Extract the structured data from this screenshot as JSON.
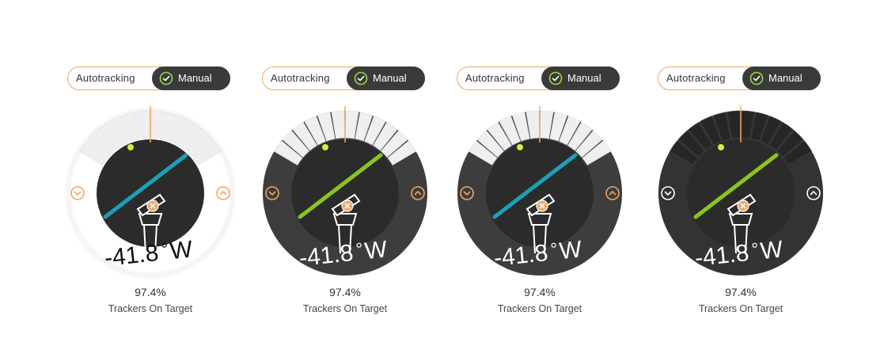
{
  "colors": {
    "accent_orange": "#f0a75f",
    "dial_dark": "#2b2b2b",
    "dial_ring_dark": "#3d3d3d",
    "blue_line": "#1aa0b8",
    "green_line": "#8cc41e",
    "dot_yellow": "#d8ef3c"
  },
  "icons": [
    "check-circle-icon",
    "chevron-down-icon",
    "chevron-up-icon",
    "tracker-icon",
    "target-x-icon"
  ],
  "cards": [
    {
      "toggle": {
        "auto_label": "Autotracking",
        "manual_label": "Manual"
      },
      "angle_value": "-41.8",
      "angle_unit": "°",
      "angle_dir": "W",
      "percent": "97.4%",
      "caption": "Trackers On Target",
      "theme": "light",
      "line_color": "blue",
      "control_style": "orange"
    },
    {
      "toggle": {
        "auto_label": "Autotracking",
        "manual_label": "Manual"
      },
      "angle_value": "-41.8",
      "angle_unit": "°",
      "angle_dir": "W",
      "percent": "97.4%",
      "caption": "Trackers On Target",
      "theme": "dark",
      "line_color": "green",
      "control_style": "orange"
    },
    {
      "toggle": {
        "auto_label": "Autotracking",
        "manual_label": "Manual"
      },
      "angle_value": "-41.8",
      "angle_unit": "°",
      "angle_dir": "W",
      "percent": "97.4%",
      "caption": "Trackers On Target",
      "theme": "dark",
      "line_color": "blue",
      "control_style": "orange"
    },
    {
      "toggle": {
        "auto_label": "Autotracking",
        "manual_label": "Manual"
      },
      "angle_value": "-41.8",
      "angle_unit": "°",
      "angle_dir": "W",
      "percent": "97.4%",
      "caption": "Trackers On Target",
      "theme": "darkest",
      "line_color": "green",
      "control_style": "white"
    }
  ]
}
